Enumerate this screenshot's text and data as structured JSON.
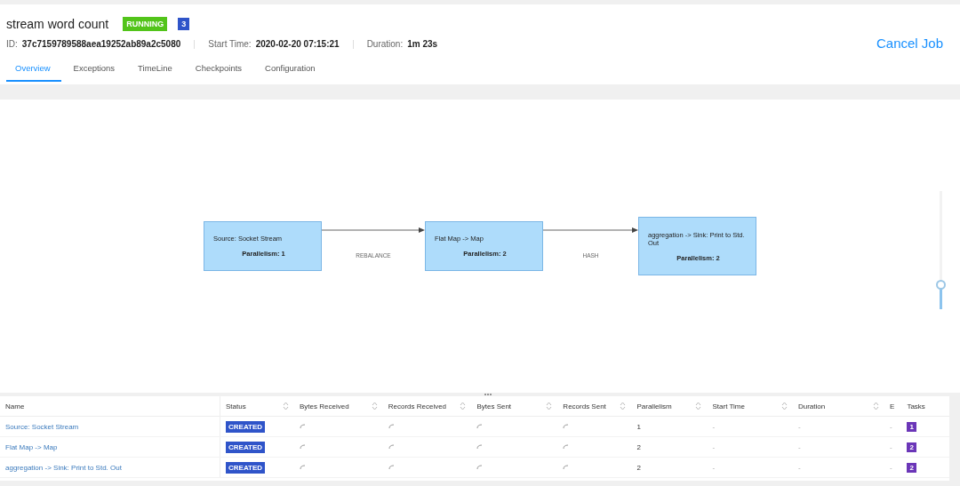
{
  "job": {
    "name": "stream word count",
    "status": "RUNNING",
    "count": "3",
    "id_label": "ID:",
    "id": "37c7159789588aea19252ab89a2c5080",
    "start_label": "Start Time:",
    "start": "2020-02-20 07:15:21",
    "duration_label": "Duration:",
    "duration": "1m 23s",
    "cancel": "Cancel Job"
  },
  "tabs": [
    {
      "label": "Overview",
      "selected": true
    },
    {
      "label": "Exceptions",
      "selected": false
    },
    {
      "label": "TimeLine",
      "selected": false
    },
    {
      "label": "Checkpoints",
      "selected": false
    },
    {
      "label": "Configuration",
      "selected": false
    }
  ],
  "graph": {
    "nodes": [
      {
        "name": "Source: Socket Stream",
        "parallelism": "Parallelism: 1"
      },
      {
        "name": "Flat Map -> Map",
        "parallelism": "Parallelism: 2"
      },
      {
        "name": "aggregation -> Sink: Print to Std. Out",
        "parallelism": "Parallelism: 2"
      }
    ],
    "edges": [
      {
        "label": "REBALANCE"
      },
      {
        "label": "HASH"
      }
    ],
    "zoom": {
      "level": 0.2
    }
  },
  "table": {
    "columns": [
      {
        "label": "Name",
        "sortable": false
      },
      {
        "label": "Status",
        "sortable": true
      },
      {
        "label": "Bytes Received",
        "sortable": true
      },
      {
        "label": "Records Received",
        "sortable": true
      },
      {
        "label": "Bytes Sent",
        "sortable": true
      },
      {
        "label": "Records Sent",
        "sortable": true
      },
      {
        "label": "Parallelism",
        "sortable": true
      },
      {
        "label": "Start Time",
        "sortable": true
      },
      {
        "label": "Duration",
        "sortable": true
      },
      {
        "label": "E",
        "sortable": false
      },
      {
        "label": "Tasks",
        "sortable": false
      }
    ],
    "rows": [
      {
        "name": "Source: Socket Stream",
        "status": "CREATED",
        "parallelism": "1",
        "start": "-",
        "duration": "-",
        "end": "-",
        "tasks": "1"
      },
      {
        "name": "Flat Map -> Map",
        "status": "CREATED",
        "parallelism": "2",
        "start": "-",
        "duration": "-",
        "end": "-",
        "tasks": "2"
      },
      {
        "name": "aggregation -> Sink: Print to Std. Out",
        "status": "CREATED",
        "parallelism": "2",
        "start": "-",
        "duration": "-",
        "end": "-",
        "tasks": "2"
      }
    ]
  }
}
